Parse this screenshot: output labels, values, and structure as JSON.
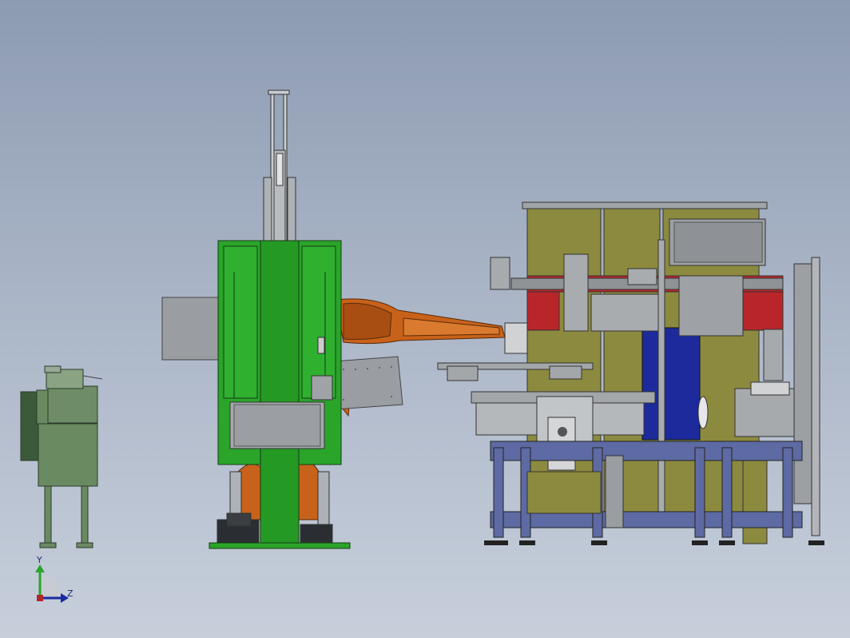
{
  "triad": {
    "y_label": "Y",
    "z_label": "Z"
  },
  "colors": {
    "background_top": "#8d9bb2",
    "background_bottom": "#c7cfdb",
    "machine_green": "#2aa52a",
    "robot_orange": "#c8621a",
    "panel_olive": "#8c8a3e",
    "accent_red": "#b8262a",
    "accent_blue": "#1c2a9c",
    "frame_steel": "#5d6aa3",
    "metal_grey": "#8f9396",
    "feeder_green": "#6a8a62"
  }
}
